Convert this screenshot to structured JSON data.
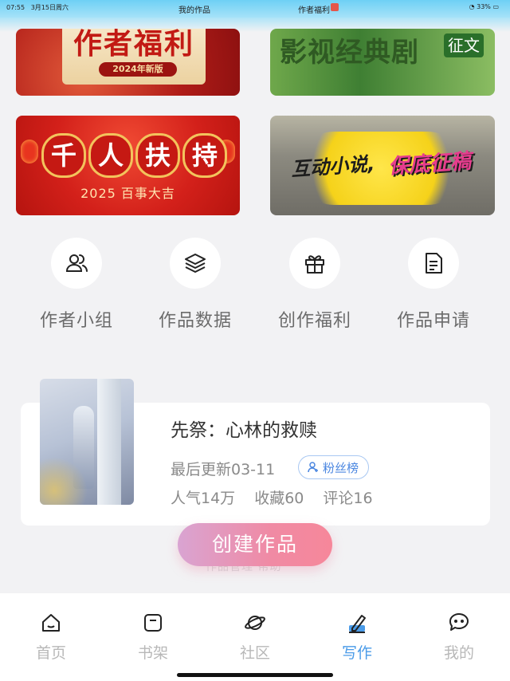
{
  "status_bar": {
    "time": "07:55",
    "date": "3月15日周六",
    "tab_left": "我的作品",
    "tab_right": "作者福利",
    "battery": "33%"
  },
  "banners": [
    {
      "title": "作者福利",
      "subtitle": "2024年新版"
    },
    {
      "title": "影视经典剧",
      "tag": "征文"
    },
    {
      "chars": [
        "千",
        "人",
        "扶",
        "持"
      ],
      "subtitle": "2025 百事大吉"
    },
    {
      "title_part1": "互动小说,",
      "title_part2": "保底征稿"
    }
  ],
  "quick_actions": [
    {
      "label": "作者小组",
      "icon": "group-icon"
    },
    {
      "label": "作品数据",
      "icon": "layers-icon"
    },
    {
      "label": "创作福利",
      "icon": "gift-icon"
    },
    {
      "label": "作品申请",
      "icon": "document-icon"
    }
  ],
  "work": {
    "title": "先祭：心林的救赎",
    "updated": "最后更新03-11",
    "fans_label": "粉丝榜",
    "popularity": "人气14万",
    "favorites": "收藏60",
    "comments": "评论16"
  },
  "create_button": "创建作品",
  "ghost_text": "作品管理 帮助",
  "tabs": [
    {
      "label": "首页",
      "icon": "home-icon"
    },
    {
      "label": "书架",
      "icon": "bookshelf-icon"
    },
    {
      "label": "社区",
      "icon": "planet-icon"
    },
    {
      "label": "写作",
      "icon": "write-icon"
    },
    {
      "label": "我的",
      "icon": "message-icon"
    }
  ],
  "colors": {
    "accent_blue": "#4a9be8",
    "create_gradient_start": "#d9a4d2",
    "create_gradient_end": "#f6879a",
    "status_bar": "#6ed0f5"
  }
}
